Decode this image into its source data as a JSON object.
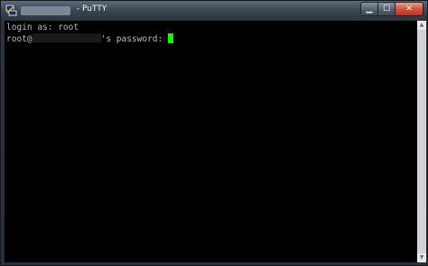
{
  "window": {
    "title_suffix": " - PuTTY",
    "minimize_glyph": "▁",
    "maximize_glyph": "☐",
    "close_glyph": "✕"
  },
  "terminal": {
    "line1": "login as: root",
    "line2_prefix": "root@",
    "line2_suffix": "'s password: "
  },
  "scrollbar": {
    "up_glyph": "▲",
    "down_glyph": "▼"
  },
  "colors": {
    "terminal_bg": "#000000",
    "terminal_fg": "#bbbbbb",
    "cursor": "#00ff00",
    "close_button": "#c8452b"
  },
  "icons": {
    "app": "putty-icon"
  }
}
